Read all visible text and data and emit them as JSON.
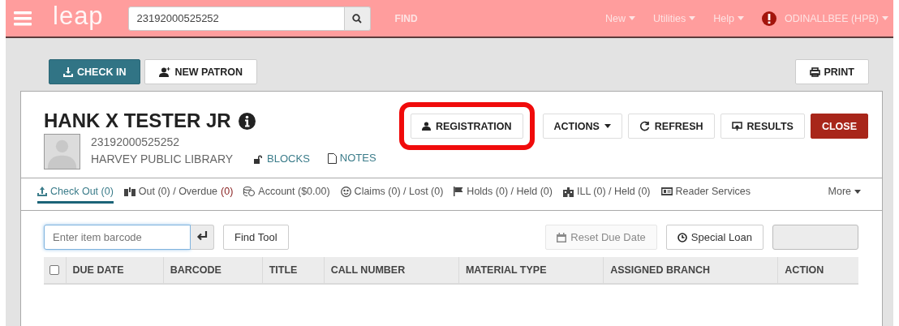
{
  "navbar": {
    "logo": "leap",
    "search": {
      "value": "23192000525252"
    },
    "find": "FIND",
    "menus": [
      "New",
      "Utilities",
      "Help"
    ],
    "user": "ODINALLBEE (HPB)"
  },
  "toolbar": {
    "buttons": [
      {
        "label": "CHECK IN",
        "kind": "checkin"
      },
      {
        "label": "NEW PATRON",
        "kind": "newpatron"
      }
    ],
    "print": "PRINT"
  },
  "patron": {
    "name": "HANK X TESTER JR",
    "barcode": "23192000525252",
    "library": "HARVEY PUBLIC LIBRARY",
    "links": [
      {
        "label": "BLOCKS",
        "kind": "blocks"
      },
      {
        "label": "NOTES",
        "kind": "notes"
      }
    ],
    "buttons": [
      {
        "label": "REGISTRATION",
        "kind": "registration",
        "highlighted": true
      },
      {
        "label": "ACTIONS",
        "kind": "actions",
        "highlighted": false
      },
      {
        "label": "REFRESH",
        "kind": "refresh",
        "highlighted": false
      },
      {
        "label": "RESULTS",
        "kind": "results",
        "highlighted": false
      },
      {
        "label": "CLOSE",
        "kind": "close",
        "highlighted": false
      }
    ]
  },
  "tabs": [
    {
      "label": "Check Out (0)",
      "kind": "checkout",
      "selected": true
    },
    {
      "label": "Out (0) / Overdue",
      "alert": "(0)",
      "kind": "out",
      "selected": false
    },
    {
      "label": "Account ($0.00)",
      "kind": "account",
      "selected": false
    },
    {
      "label": "Claims (0) / Lost (0)",
      "kind": "claims",
      "selected": false
    },
    {
      "label": "Holds (0) / Held (0)",
      "kind": "holds",
      "selected": false
    },
    {
      "label": "ILL (0) / Held (0)",
      "kind": "ill",
      "selected": false
    },
    {
      "label": "Reader Services",
      "kind": "reader",
      "selected": false
    }
  ],
  "more": "More",
  "checkout": {
    "barcode_field": {
      "placeholder": "Enter item barcode"
    },
    "find_tool": "Find Tool",
    "reset_due_date": {
      "label": "Reset Due Date",
      "disabled": true
    },
    "special_loan": "Special Loan"
  },
  "table": {
    "columns": [
      "DUE DATE",
      "BARCODE",
      "TITLE",
      "CALL NUMBER",
      "MATERIAL TYPE",
      "ASSIGNED BRANCH",
      "ACTION"
    ],
    "select_all": {
      "checked": false
    }
  }
}
